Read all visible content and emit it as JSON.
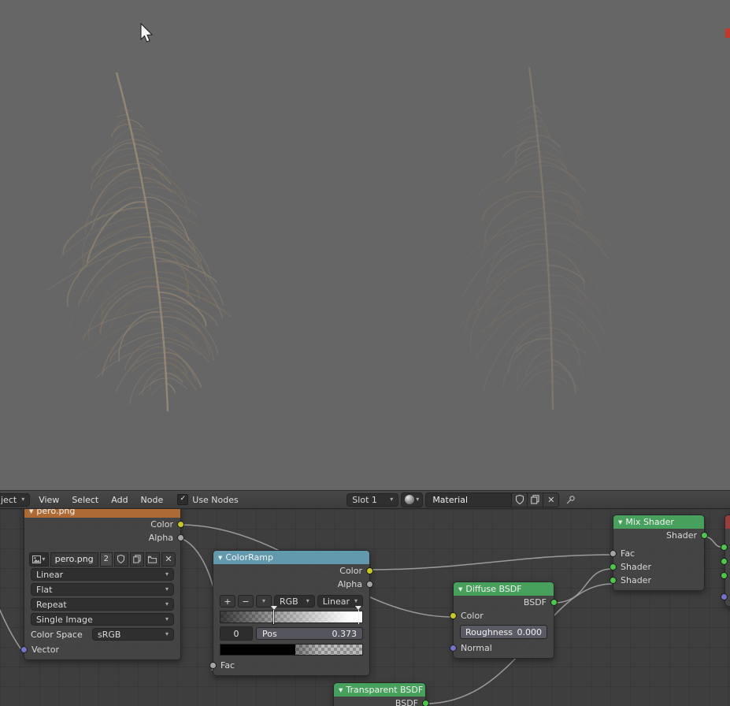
{
  "editor_header": {
    "breadcrumb_label": "ject",
    "menu_view": "View",
    "menu_select": "Select",
    "menu_add": "Add",
    "menu_node": "Node",
    "use_nodes_check": "✓",
    "use_nodes_label": "Use Nodes",
    "slot": "Slot 1",
    "material_name": "Material",
    "close_label": "✕"
  },
  "nodes": {
    "image_texture": {
      "title": "pero.png",
      "out_color": "Color",
      "out_alpha": "Alpha",
      "filename": "pero.png",
      "user_count": "2",
      "interpolation": "Linear",
      "projection": "Flat",
      "extension": "Repeat",
      "source": "Single Image",
      "color_space_label": "Color Space",
      "color_space_value": "sRGB",
      "in_vector": "Vector",
      "unlink_label": "✕"
    },
    "color_ramp": {
      "title": "ColorRamp",
      "out_color": "Color",
      "out_alpha": "Alpha",
      "btn_add": "+",
      "btn_remove": "−",
      "color_mode": "RGB",
      "interpolation": "Linear",
      "stop_index": "0",
      "pos_label": "Pos",
      "pos_value": "0.373",
      "in_fac": "Fac"
    },
    "diffuse_bsdf": {
      "title": "Diffuse BSDF",
      "out_bsdf": "BSDF",
      "in_color": "Color",
      "roughness_label": "Roughness",
      "roughness_value": "0.000",
      "in_normal": "Normal"
    },
    "mix_shader": {
      "title": "Mix Shader",
      "out_shader": "Shader",
      "in_fac": "Fac",
      "in_shader1": "Shader",
      "in_shader2": "Shader"
    },
    "transparent_bsdf": {
      "title": "Transparent BSDF",
      "out_bsdf": "BSDF"
    },
    "material_output": {
      "title": ""
    }
  },
  "colors": {
    "socket_color": "#c7c729",
    "socket_shader": "#4cc74c",
    "socket_value": "#a5a5a5",
    "socket_vector": "#7473c9",
    "header_texture": "#ad6a35",
    "header_converter": "#6399ad",
    "header_shader": "#47a05b",
    "header_output": "#993c3c",
    "viewport_bg": "#666667",
    "editor_bg": "#3e3e3e",
    "wire": "#9b9b9b"
  }
}
